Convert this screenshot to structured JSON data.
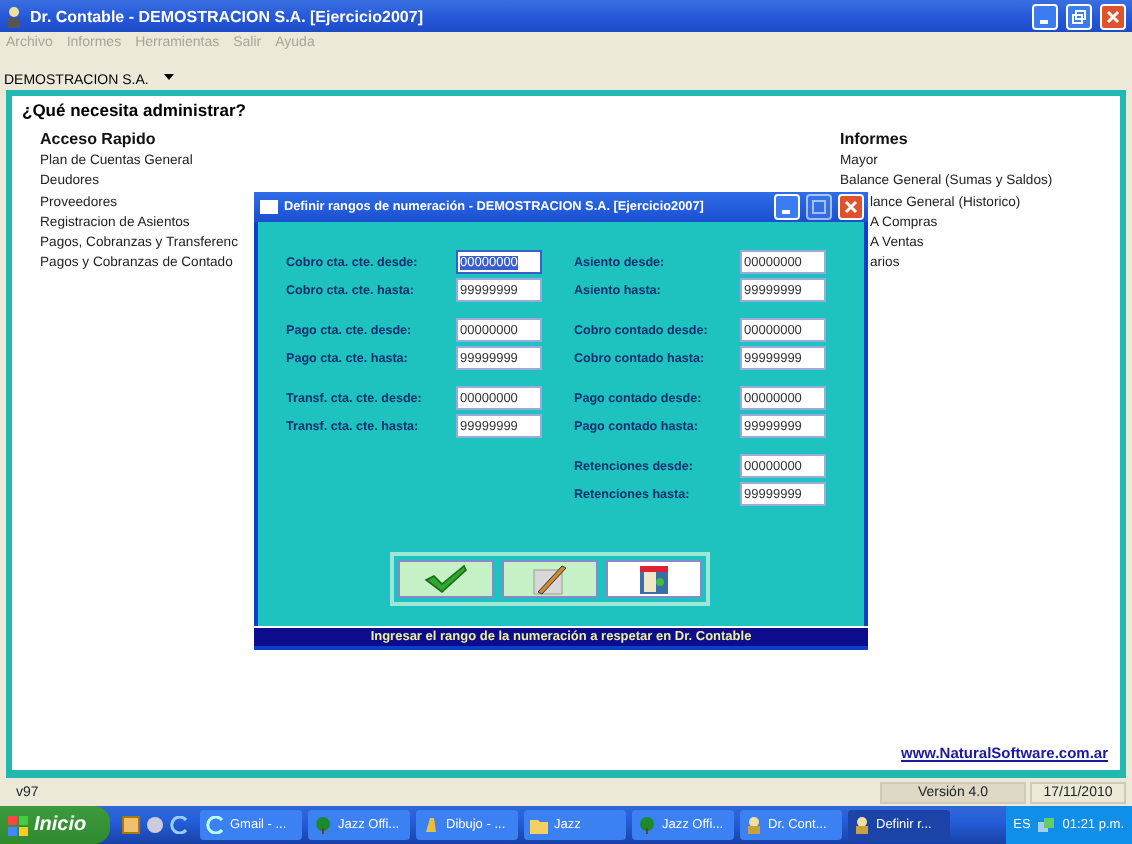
{
  "window": {
    "title": "Dr. Contable - DEMOSTRACION S.A.  [Ejercicio2007]"
  },
  "menu": [
    "Archivo",
    "Informes",
    "Herramientas",
    "Salir",
    "Ayuda"
  ],
  "company_selector": {
    "value": "DEMOSTRACION S.A."
  },
  "heading": "¿Qué necesita administrar?",
  "quick_access": {
    "title": "Acceso Rapido",
    "items": [
      "Plan de Cuentas General",
      "Deudores",
      "Proveedores",
      "Registracion de Asientos",
      "Pagos, Cobranzas y Transferenc",
      "Pagos y Cobranzas de Contado"
    ]
  },
  "reports": {
    "title": "Informes",
    "items": [
      "Mayor",
      "Balance General (Sumas y Saldos)",
      "lance General (Historico)",
      "A Compras",
      "A Ventas",
      "arios"
    ]
  },
  "website_link": "www.NaturalSoftware.com.ar",
  "status_bar": {
    "left": "v97",
    "version": "Versión 4.0",
    "date": "17/11/2010"
  },
  "dialog": {
    "title": "Definir rangos de numeración - DEMOSTRACION S.A.  [Ejercicio2007]",
    "left_groups": [
      [
        {
          "label": "Cobro cta. cte. desde:",
          "value": "00000000",
          "focused": true
        },
        {
          "label": "Cobro cta. cte. hasta:",
          "value": "99999999",
          "focused": false
        }
      ],
      [
        {
          "label": "Pago cta. cte. desde:",
          "value": "00000000",
          "focused": false
        },
        {
          "label": "Pago cta. cte. hasta:",
          "value": "99999999",
          "focused": false
        }
      ],
      [
        {
          "label": "Transf. cta. cte. desde:",
          "value": "00000000",
          "focused": false
        },
        {
          "label": "Transf. cta. cte. hasta:",
          "value": "99999999",
          "focused": false
        }
      ]
    ],
    "right_groups": [
      [
        {
          "label": "Asiento desde:",
          "value": "00000000",
          "focused": false
        },
        {
          "label": "Asiento hasta:",
          "value": "99999999",
          "focused": false
        }
      ],
      [
        {
          "label": "Cobro contado desde:",
          "value": "00000000",
          "focused": false
        },
        {
          "label": "Cobro contado hasta:",
          "value": "99999999",
          "focused": false
        }
      ],
      [
        {
          "label": "Pago contado desde:",
          "value": "00000000",
          "focused": false
        },
        {
          "label": "Pago contado hasta:",
          "value": "99999999",
          "focused": false
        }
      ],
      [
        {
          "label": "Retenciones desde:",
          "value": "00000000",
          "focused": false
        },
        {
          "label": "Retenciones hasta:",
          "value": "99999999",
          "focused": false
        }
      ]
    ],
    "buttons": [
      {
        "kind": "accept"
      },
      {
        "kind": "edit"
      },
      {
        "kind": "exit"
      }
    ],
    "hint": "Ingresar el rango de la numeración a respetar en Dr. Contable"
  },
  "taskbar": {
    "start": "Inicio",
    "tasks": [
      {
        "label": "Gmail - ...",
        "selected": false,
        "kind": "browser"
      },
      {
        "label": "Jazz Offi...",
        "selected": false,
        "kind": "tree"
      },
      {
        "label": "Dibujo - ...",
        "selected": false,
        "kind": "paint"
      },
      {
        "label": "Jazz",
        "selected": false,
        "kind": "folder"
      },
      {
        "label": "Jazz Offi...",
        "selected": false,
        "kind": "tree"
      },
      {
        "label": "Dr. Cont...",
        "selected": false,
        "kind": "app"
      },
      {
        "label": "Definir r...",
        "selected": true,
        "kind": "app"
      }
    ],
    "language": "ES",
    "clock": "01:21 p.m."
  }
}
